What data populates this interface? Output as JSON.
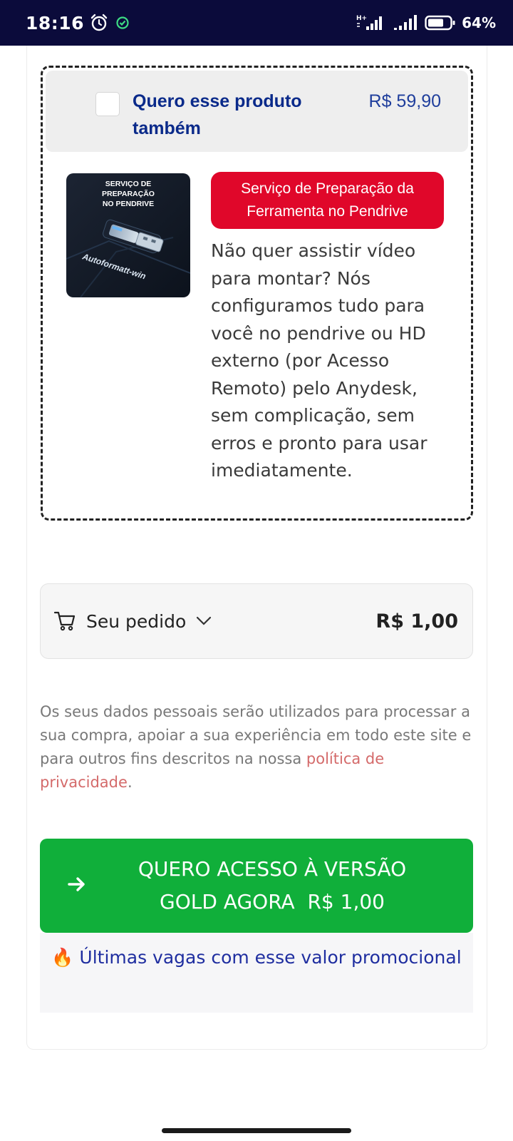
{
  "status_bar": {
    "time": "18:16",
    "network": "H+",
    "battery": "64%"
  },
  "order_bump": {
    "checked": false,
    "title": "Quero esse produto também",
    "price": "R$ 59,90",
    "image_text": {
      "line1": "SERVIÇO DE",
      "line2": "PREPARAÇÃO",
      "line3": "NO PENDRIVE",
      "brand": "Autoformatt-win"
    },
    "badge": "Serviço de Preparação da Ferramenta no Pendrive",
    "description": "Não quer assistir vídeo para montar? Nós configuramos tudo para você no pendrive ou HD externo (por Acesso Remoto) pelo Anydesk, sem complicação, sem erros e pronto para usar imediatamente."
  },
  "order_summary": {
    "label": "Seu pedido",
    "total": "R$ 1,00"
  },
  "privacy": {
    "text": "Os seus dados pessoais serão utilizados para processar a sua compra, apoiar a sua experiência em todo este site e para outros fins descritos na nossa",
    "link": "política de privacidade",
    "end": "."
  },
  "cta": {
    "line1": "QUERO ACESSO À VERSÃO",
    "line2": "GOLD AGORA  R$ 1,00"
  },
  "urgency": {
    "emoji": "🔥",
    "text": "Últimas vagas com esse valor promocional"
  },
  "colors": {
    "status_bar": "#0b0b3b",
    "title_blue": "#0a2a8a",
    "badge_red": "#e0072a",
    "cta_green": "#10af3a",
    "link_red": "#d46a6a"
  }
}
